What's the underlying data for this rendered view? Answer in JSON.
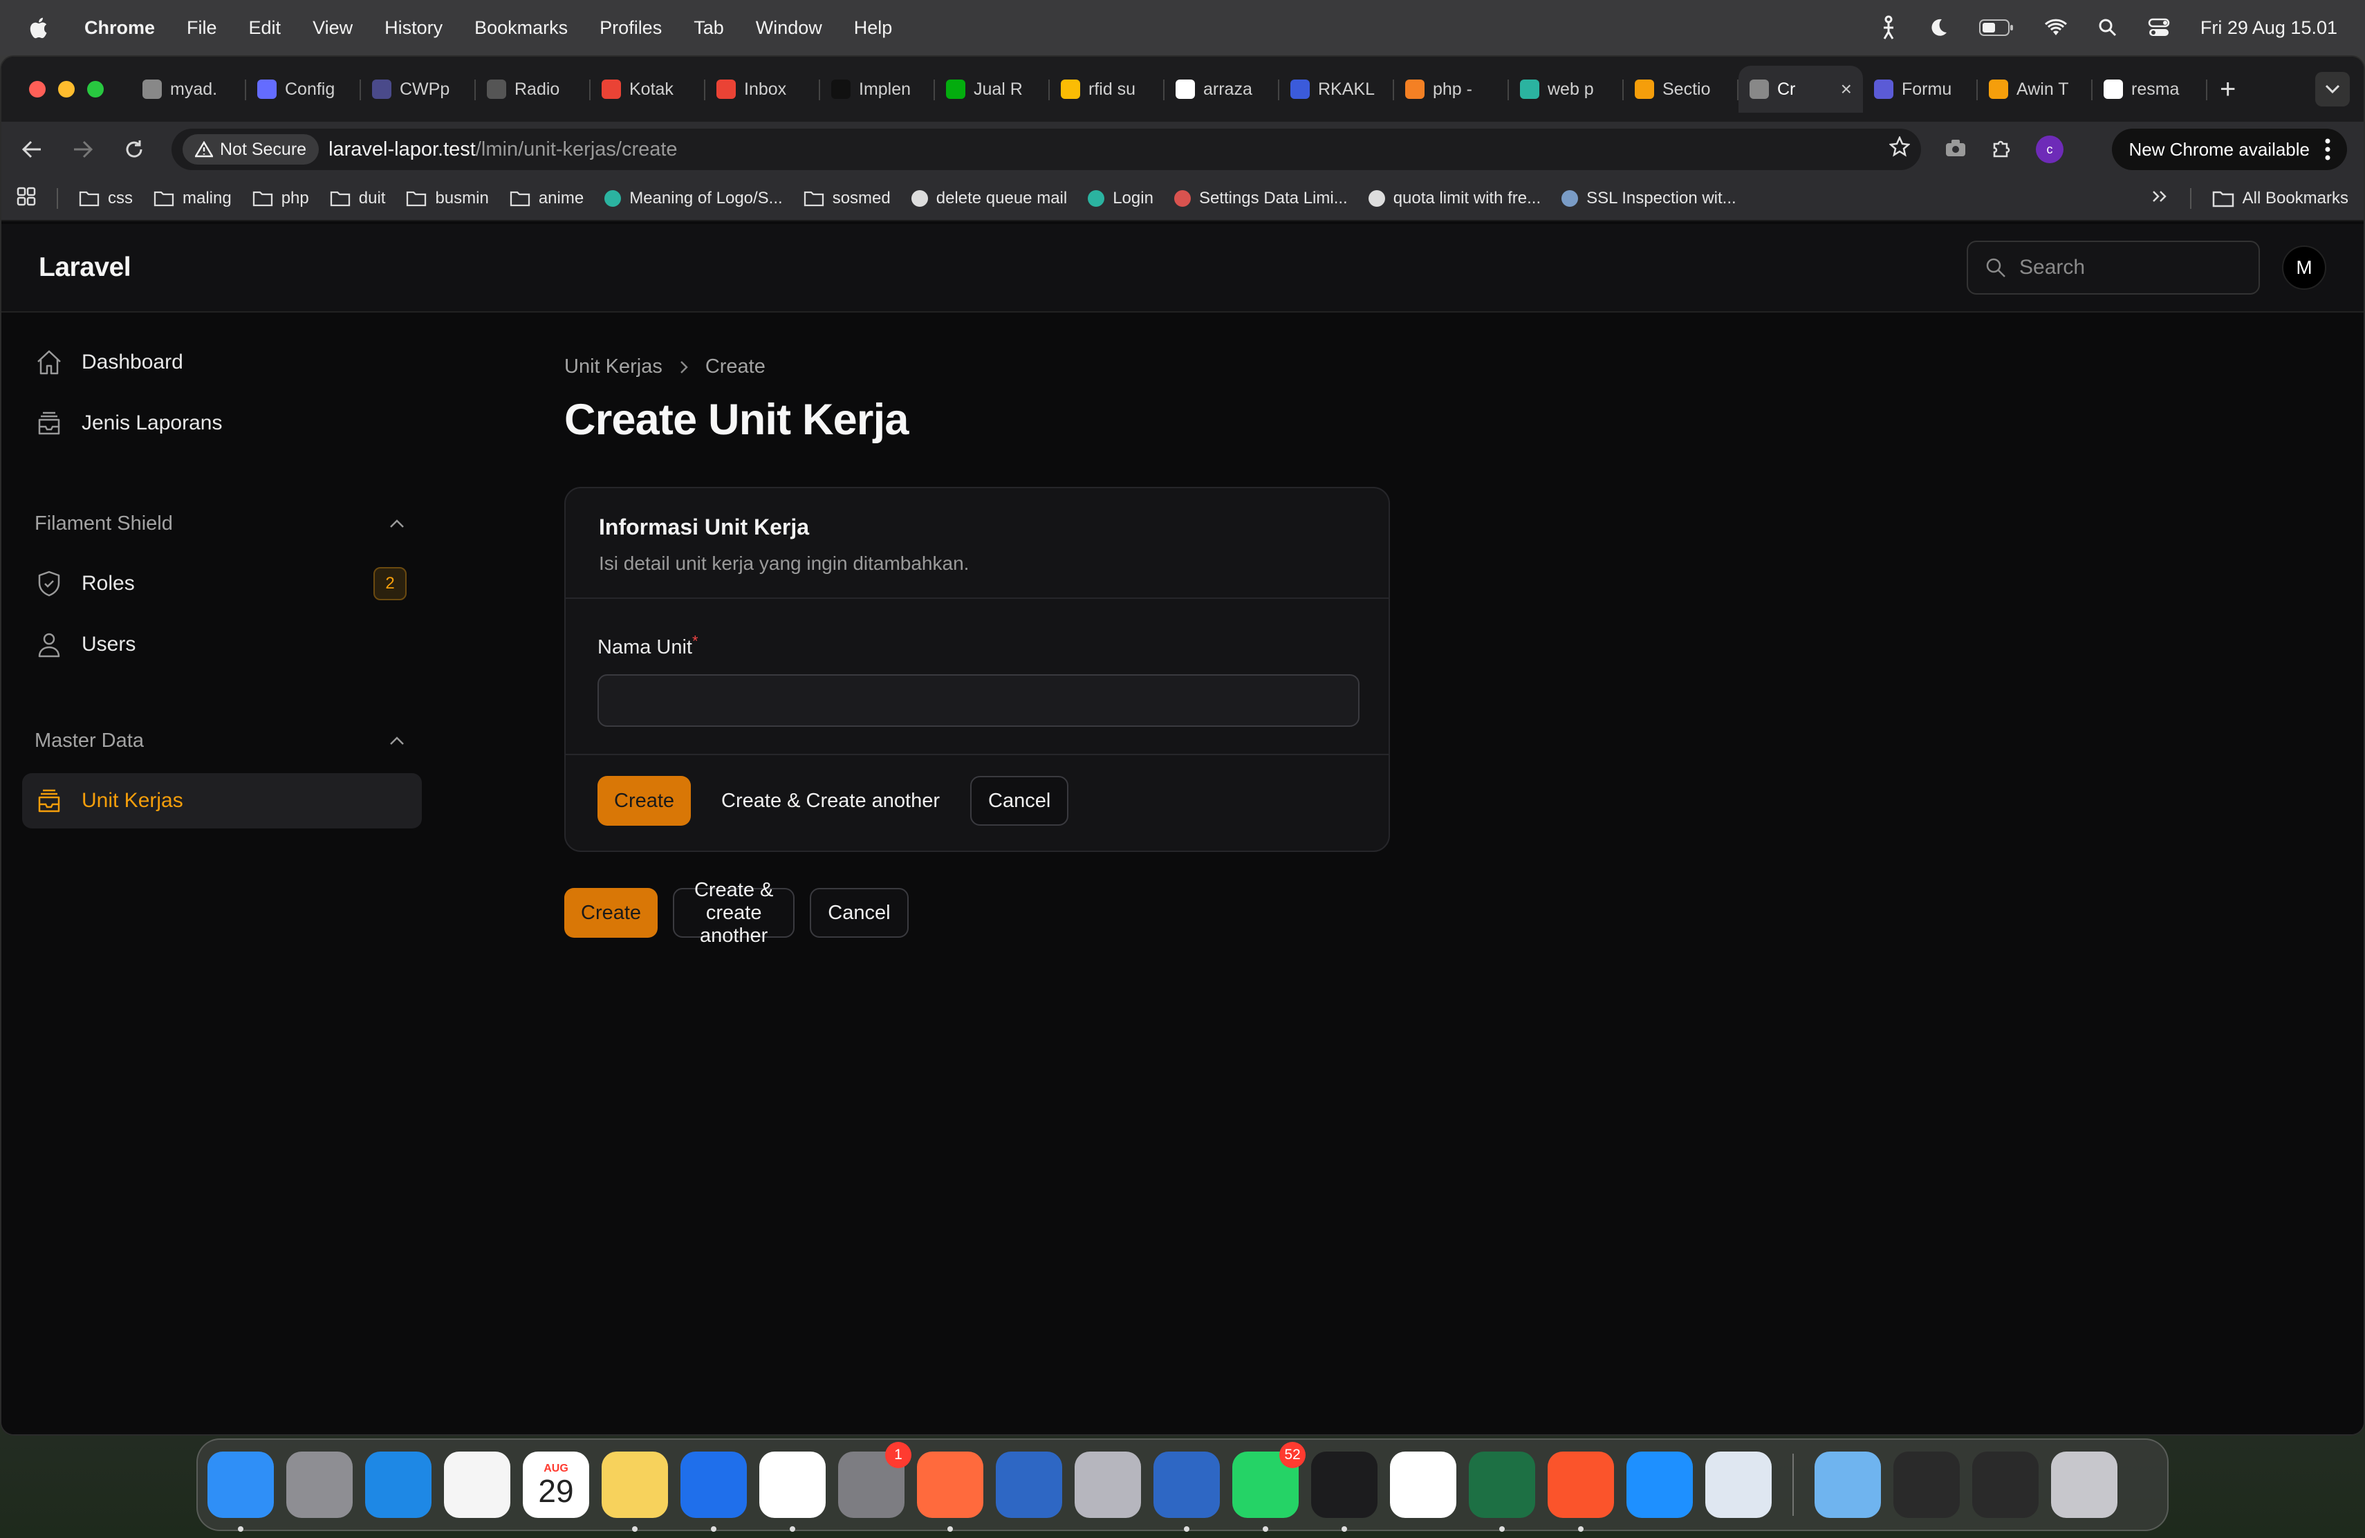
{
  "menubar": {
    "app_name": "Chrome",
    "items": [
      "File",
      "Edit",
      "View",
      "History",
      "Bookmarks",
      "Profiles",
      "Tab",
      "Window",
      "Help"
    ],
    "clock": "Fri 29 Aug  15.01"
  },
  "browser": {
    "tabs": [
      {
        "label": "myad.",
        "icon": "globe-icon",
        "color": "#888888"
      },
      {
        "label": "Config",
        "icon": "vite-icon",
        "color": "#646cff"
      },
      {
        "label": "CWPp",
        "icon": "cwp-icon",
        "color": "#4a4a8a"
      },
      {
        "label": "Radio",
        "icon": "openai-icon",
        "color": "#555555"
      },
      {
        "label": "Kotak",
        "icon": "gmail-icon",
        "color": "#ea4335"
      },
      {
        "label": "Inbox",
        "icon": "gmail-icon",
        "color": "#ea4335"
      },
      {
        "label": "Implen",
        "icon": "medium-icon",
        "color": "#111111"
      },
      {
        "label": "Jual R",
        "icon": "tokopedia-icon",
        "color": "#03ac0e"
      },
      {
        "label": "rfid su",
        "icon": "drive-icon",
        "color": "#fbbc04"
      },
      {
        "label": "arraza",
        "icon": "github-icon",
        "color": "#ffffff"
      },
      {
        "label": "RKAKL",
        "icon": "rkakl-icon",
        "color": "#3b5bdb"
      },
      {
        "label": "php - ",
        "icon": "stackoverflow-icon",
        "color": "#f48024"
      },
      {
        "label": "web p",
        "icon": "web-icon",
        "color": "#2bb3a0"
      },
      {
        "label": "Sectio",
        "icon": "filament-icon",
        "color": "#f59e0b"
      },
      {
        "label": "Cr",
        "icon": "globe-icon",
        "color": "#888888",
        "active": true
      },
      {
        "label": "Formu",
        "icon": "form-icon",
        "color": "#5b5bd6"
      },
      {
        "label": "Awin T",
        "icon": "filament-icon",
        "color": "#f59e0b"
      },
      {
        "label": "resma",
        "icon": "github-icon",
        "color": "#ffffff"
      }
    ],
    "security_label": "Not Secure",
    "url_host": "laravel-lapor.test",
    "url_path": "/lmin/unit-kerjas/create",
    "update_label": "New Chrome available",
    "profile_initial": "c",
    "bookmarks": [
      {
        "label": "css",
        "type": "folder"
      },
      {
        "label": "maling",
        "type": "folder"
      },
      {
        "label": "php",
        "type": "folder"
      },
      {
        "label": "duit",
        "type": "folder"
      },
      {
        "label": "busmin",
        "type": "folder"
      },
      {
        "label": "anime",
        "type": "folder"
      },
      {
        "label": "Meaning of Logo/S...",
        "type": "link",
        "color": "#2bb3a0"
      },
      {
        "label": "sosmed",
        "type": "folder"
      },
      {
        "label": "delete queue mail",
        "type": "link",
        "color": "#dddddd"
      },
      {
        "label": "Login",
        "type": "link",
        "color": "#2bb3a0"
      },
      {
        "label": "Settings Data Limi...",
        "type": "link",
        "color": "#d9534f"
      },
      {
        "label": "quota limit with fre...",
        "type": "link",
        "color": "#dddddd"
      },
      {
        "label": "SSL Inspection wit...",
        "type": "link",
        "color": "#7a9cc6"
      }
    ],
    "all_bookmarks": "All Bookmarks"
  },
  "app": {
    "brand": "Laravel",
    "search_placeholder": "Search",
    "avatar_initial": "M",
    "accent": "#d97706",
    "sidebar": {
      "top_items": [
        {
          "label": "Dashboard",
          "icon": "home-icon"
        },
        {
          "label": "Jenis Laporans",
          "icon": "inbox-stack-icon"
        }
      ],
      "groups": [
        {
          "label": "Filament Shield",
          "items": [
            {
              "label": "Roles",
              "icon": "shield-icon",
              "badge": "2"
            },
            {
              "label": "Users",
              "icon": "user-icon"
            }
          ]
        },
        {
          "label": "Master Data",
          "items": [
            {
              "label": "Unit Kerjas",
              "icon": "inbox-stack-icon",
              "active": true
            }
          ]
        }
      ]
    },
    "breadcrumb": [
      "Unit Kerjas",
      "Create"
    ],
    "title": "Create Unit Kerja",
    "card": {
      "title": "Informasi Unit Kerja",
      "description": "Isi detail unit kerja yang ingin ditambahkan.",
      "field_label": "Nama Unit",
      "field_required": "*",
      "field_value": "",
      "actions": {
        "create": "Create",
        "create_another": "Create & Create another",
        "cancel": "Cancel"
      }
    },
    "page_actions": {
      "create": "Create",
      "create_another": "Create & create another",
      "cancel": "Cancel"
    }
  },
  "dock": {
    "apps": [
      {
        "name": "Finder",
        "icon": "finder-icon",
        "color": "#2f8ff7",
        "running": true
      },
      {
        "name": "Launchpad",
        "icon": "launchpad-icon",
        "color": "#8e8e93"
      },
      {
        "name": "Safari",
        "icon": "safari-icon",
        "color": "#1e88e5"
      },
      {
        "name": "Photos",
        "icon": "photos-icon",
        "color": "#f5f5f5"
      },
      {
        "name": "Calendar",
        "icon": "calendar-icon",
        "color": "#ffffff",
        "month": "AUG",
        "day": "29"
      },
      {
        "name": "Notes",
        "icon": "notes-icon",
        "color": "#f7d25c",
        "running": true
      },
      {
        "name": "VS Code",
        "icon": "vscode-icon",
        "color": "#1f6feb",
        "running": true
      },
      {
        "name": "Chrome",
        "icon": "chrome-icon",
        "color": "#ffffff",
        "running": true
      },
      {
        "name": "System Settings",
        "icon": "settings-icon",
        "color": "#7d7d82",
        "badge": "1"
      },
      {
        "name": "Pencil",
        "icon": "pencil-icon",
        "color": "#ff6a3d",
        "running": true
      },
      {
        "name": "WebStorm",
        "icon": "webstorm-icon",
        "color": "#2e67c4"
      },
      {
        "name": "iPhone Mirroring",
        "icon": "iphone-icon",
        "color": "#b6b6be"
      },
      {
        "name": "WebStorm 2",
        "icon": "webstorm-icon",
        "color": "#2e67c4",
        "running": true
      },
      {
        "name": "WhatsApp",
        "icon": "whatsapp-icon",
        "color": "#25d366",
        "badge": "52",
        "running": true
      },
      {
        "name": "Terminal",
        "icon": "terminal-icon",
        "color": "#1c1c1e",
        "running": true
      },
      {
        "name": "CapCut",
        "icon": "capcut-icon",
        "color": "#ffffff"
      },
      {
        "name": "Excel",
        "icon": "excel-icon",
        "color": "#1d7044",
        "running": true
      },
      {
        "name": "Brave",
        "icon": "brave-icon",
        "color": "#fb542b",
        "running": true
      },
      {
        "name": "App Store",
        "icon": "appstore-icon",
        "color": "#1e90ff"
      },
      {
        "name": "Preview",
        "icon": "preview-icon",
        "color": "#dfe7f1"
      }
    ],
    "stack": [
      {
        "name": "Downloads",
        "icon": "downloads-folder-icon",
        "color": "#6fb4ef"
      },
      {
        "name": "Window 1",
        "icon": "window-thumb-icon",
        "color": "#2a2a2a"
      },
      {
        "name": "Window 2",
        "icon": "window-thumb-icon",
        "color": "#2a2a2a"
      },
      {
        "name": "Trash",
        "icon": "trash-icon",
        "color": "#c7c7cc"
      }
    ]
  }
}
